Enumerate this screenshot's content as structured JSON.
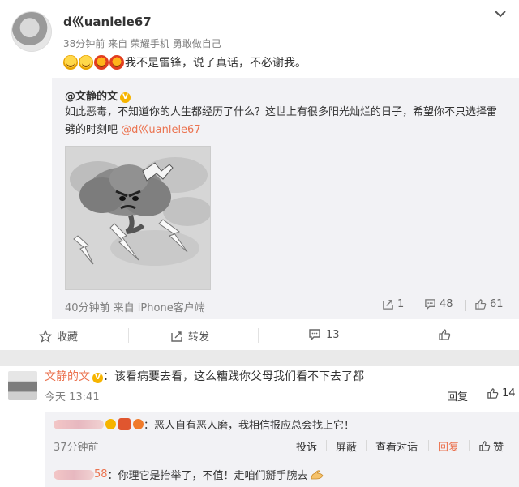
{
  "post": {
    "username": "d巛uanlele67",
    "meta": "38分钟前 来自 荣耀手机 勇敢做自己",
    "text": "我不是雷锋，说了真话，不必谢我。",
    "emojis": [
      "grin-icon",
      "grin-icon",
      "laugh-cry-icon",
      "laugh-cry-icon"
    ]
  },
  "repost": {
    "author": "@文静的文",
    "badge": "V",
    "text_line1": "如此恶毒，不知道你的人生都经历了什么？这世上有很多阳光灿烂的日子，希望你不只选择雷",
    "text_line2": "劈的时刻吧 ",
    "mention": "@d巛uanlele67",
    "meta": "40分钟前 来自 iPhone客户端",
    "shares": "1",
    "comments": "48",
    "likes": "61"
  },
  "actions": {
    "favorite": "收藏",
    "forward": "转发",
    "comment": "13",
    "like": ""
  },
  "comment": {
    "author": "文静的文",
    "badge": "V",
    "text": "：该看病要去看，这么糟践你父母我们看不下去了都",
    "time": "今天 13:41",
    "reply": "回复",
    "likes": "14"
  },
  "subreplies": [
    {
      "text": "：恶人自有恶人磨，我相信报应总会找上它！",
      "time": "37分钟前",
      "actions": [
        "投诉",
        "屏蔽",
        "查看对话",
        "回复",
        "赞"
      ]
    },
    {
      "name_tail": "58",
      "text": "：你理它是抬举了，不值！走咱们掰手腕去"
    }
  ],
  "colors": {
    "accent": "#eb7350",
    "vip": "#f6b400",
    "panel": "#f2f2f5"
  }
}
